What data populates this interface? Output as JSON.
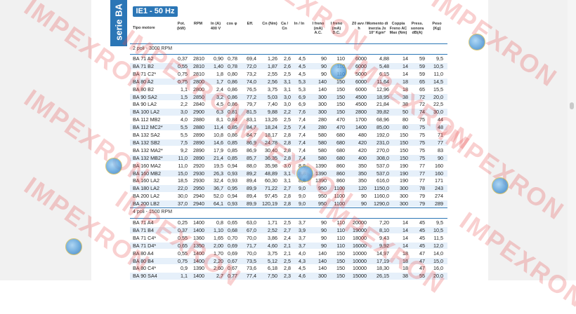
{
  "side_tab": "serie BA",
  "badge": "IE1 - 50 Hz",
  "headers": [
    "Tipo motore",
    "Pot. (kW)",
    "RPM",
    "In (A) 400 V",
    "cos φ",
    "Eff.",
    "Cn (Nm)",
    "Ca / Cn",
    "In / In",
    "I freno (mA) A.C.",
    "I freno (mA) D.C.",
    "Z0 avv / h",
    "Momento di inerzia Jx 10³ Kgm²",
    "Coppia Freno AC Max (Nm)",
    "Press. sonora dB(A)",
    "Peso (Kg)"
  ],
  "section1": "2 poli - 3000 RPM",
  "section2": "4 poli - 1500 RPM",
  "rows1": [
    [
      "BA 71 A2",
      "0,37",
      "2810",
      "0,90",
      "0,78",
      "69,4",
      "1,26",
      "2,6",
      "4,5",
      "90",
      "110",
      "6000",
      "4,88",
      "14",
      "59",
      "9,5"
    ],
    [
      "BA 71 B2",
      "0,55",
      "2810",
      "1,40",
      "0,78",
      "72,0",
      "1,87",
      "2,6",
      "4,5",
      "90",
      "110",
      "6000",
      "5,48",
      "14",
      "59",
      "10,5"
    ],
    [
      "BA 71 C2*",
      "0,75",
      "2810",
      "1,8",
      "0,80",
      "73,2",
      "2,55",
      "2,5",
      "4,5",
      "90",
      "110",
      "5000",
      "6,15",
      "14",
      "59",
      "11,0"
    ],
    [
      "BA 80 A2",
      "0,75",
      "2800",
      "1,7",
      "0,86",
      "74,0",
      "2,56",
      "3,1",
      "5,3",
      "140",
      "150",
      "6000",
      "11,64",
      "18",
      "65",
      "14,5"
    ],
    [
      "BA 80 B2",
      "1,1",
      "2800",
      "2,4",
      "0,86",
      "76,5",
      "3,75",
      "3,1",
      "5,3",
      "140",
      "150",
      "6000",
      "12,96",
      "18",
      "65",
      "15,5"
    ],
    [
      "BA 90 SA2",
      "1,5",
      "2850",
      "3,2",
      "0,86",
      "77,2",
      "5,03",
      "3,0",
      "6,9",
      "300",
      "150",
      "4500",
      "18,95",
      "38",
      "72",
      "20,0"
    ],
    [
      "BA 90 LA2",
      "2,2",
      "2840",
      "4,5",
      "0,86",
      "79,7",
      "7,40",
      "3,0",
      "6,9",
      "300",
      "150",
      "4500",
      "21,84",
      "38",
      "72",
      "22,5"
    ],
    [
      "BA 100 LA2",
      "3,0",
      "2900",
      "6,3",
      "0,81",
      "81,5",
      "9,88",
      "2,2",
      "7,6",
      "300",
      "150",
      "2800",
      "39,82",
      "50",
      "74",
      "30,0"
    ],
    [
      "BA 112 MB2",
      "4,0",
      "2880",
      "8,1",
      "0,84",
      "83,1",
      "13,26",
      "2,5",
      "7,4",
      "280",
      "470",
      "1700",
      "68,96",
      "80",
      "75",
      "44"
    ],
    [
      "BA 112 MC2*",
      "5,5",
      "2880",
      "11,4",
      "0,85",
      "84,7",
      "18,24",
      "2,5",
      "7,4",
      "280",
      "470",
      "1400",
      "85,00",
      "80",
      "75",
      "48"
    ],
    [
      "BA 132 SA2",
      "5,5",
      "2890",
      "10,8",
      "0,86",
      "84,7",
      "18,17",
      "2,8",
      "7,4",
      "580",
      "680",
      "480",
      "192,0",
      "150",
      "75",
      "71"
    ],
    [
      "BA 132 SB2",
      "7,5",
      "2890",
      "14,6",
      "0,85",
      "86,9",
      "24,78",
      "2,8",
      "7,4",
      "580",
      "680",
      "420",
      "231,0",
      "150",
      "75",
      "77"
    ],
    [
      "BA 132 MA2*",
      "9,2",
      "2890",
      "17,9",
      "0,85",
      "86,9",
      "30,40",
      "2,8",
      "7,4",
      "580",
      "680",
      "420",
      "270,0",
      "150",
      "75",
      "83"
    ],
    [
      "BA 132 MB2*",
      "11,0",
      "2890",
      "21,4",
      "0,85",
      "85,7",
      "36,35",
      "2,8",
      "7,4",
      "580",
      "680",
      "400",
      "308,0",
      "150",
      "75",
      "90"
    ],
    [
      "BA 160 MA2",
      "11,0",
      "2920",
      "19,5",
      "0,94",
      "88,0",
      "35,98",
      "3,0",
      "8,8",
      "1390",
      "860",
      "350",
      "537,0",
      "190",
      "77",
      "160"
    ],
    [
      "BA 160 MB2",
      "15,0",
      "2930",
      "26,3",
      "0,93",
      "89,2",
      "48,89",
      "3,1",
      "8,8",
      "1390",
      "860",
      "350",
      "537,0",
      "190",
      "77",
      "160"
    ],
    [
      "BA 160 LA2",
      "18,5",
      "2930",
      "32,4",
      "0,93",
      "89,4",
      "60,30",
      "3,1",
      "8,8",
      "1390",
      "860",
      "350",
      "616,0",
      "190",
      "77",
      "171"
    ],
    [
      "BA 180 LA2",
      "22,0",
      "2950",
      "36,7",
      "0,95",
      "89,9",
      "71,22",
      "2,7",
      "9,0",
      "950",
      "1100",
      "120",
      "1150,0",
      "300",
      "78",
      "243"
    ],
    [
      "BA 200 LA2",
      "30,0",
      "2940",
      "52,0",
      "0,94",
      "89,4",
      "97,45",
      "2,8",
      "9,0",
      "950",
      "1100",
      "90",
      "1160,0",
      "300",
      "79",
      "274"
    ],
    [
      "BA 200 LB2",
      "37,0",
      "2940",
      "64,1",
      "0,93",
      "89,9",
      "120,19",
      "2,8",
      "9,0",
      "950",
      "1100",
      "90",
      "1290,0",
      "300",
      "79",
      "289"
    ]
  ],
  "rows2": [
    [
      "BA 71 A4",
      "0,25",
      "1400",
      "0,8",
      "0,65",
      "63,0",
      "1,71",
      "2,5",
      "3,7",
      "90",
      "110",
      "20000",
      "7,20",
      "14",
      "45",
      "9,5"
    ],
    [
      "BA 71 B4",
      "0,37",
      "1400",
      "1,10",
      "0,68",
      "67,0",
      "2,52",
      "2,7",
      "3,9",
      "90",
      "110",
      "19000",
      "8,10",
      "14",
      "45",
      "10,5"
    ],
    [
      "BA 71 C4*",
      "0,55",
      "1360",
      "1,65",
      "0,70",
      "70,0",
      "3,86",
      "2,4",
      "3,7",
      "90",
      "110",
      "18000",
      "9,43",
      "14",
      "45",
      "11,5"
    ],
    [
      "BA 71 D4*",
      "0,65",
      "1350",
      "2,00",
      "0,69",
      "71,7",
      "4,60",
      "2,1",
      "3,7",
      "90",
      "110",
      "16000",
      "9,92",
      "14",
      "45",
      "12,0"
    ],
    [
      "BA 80 A4",
      "0,55",
      "1400",
      "1,70",
      "0,69",
      "70,0",
      "3,75",
      "2,1",
      "4,0",
      "140",
      "150",
      "10000",
      "14,97",
      "18",
      "47",
      "14,0"
    ],
    [
      "BA 80 B4",
      "0,75",
      "1400",
      "2,20",
      "0,67",
      "73,5",
      "5,12",
      "2,5",
      "4,3",
      "140",
      "150",
      "10000",
      "17,19",
      "18",
      "47",
      "15,0"
    ],
    [
      "BA 80 C4*",
      "0,9",
      "1390",
      "2,60",
      "0,67",
      "73,6",
      "6,18",
      "2,8",
      "4,5",
      "140",
      "150",
      "10000",
      "18,30",
      "18",
      "47",
      "16,0"
    ],
    [
      "BA 90 SA4",
      "1,1",
      "1400",
      "2,7",
      "0,77",
      "77,4",
      "7,50",
      "2,3",
      "4,6",
      "300",
      "150",
      "15000",
      "26,15",
      "38",
      "55",
      "20,0"
    ]
  ],
  "watermark": "IMPEXRON"
}
